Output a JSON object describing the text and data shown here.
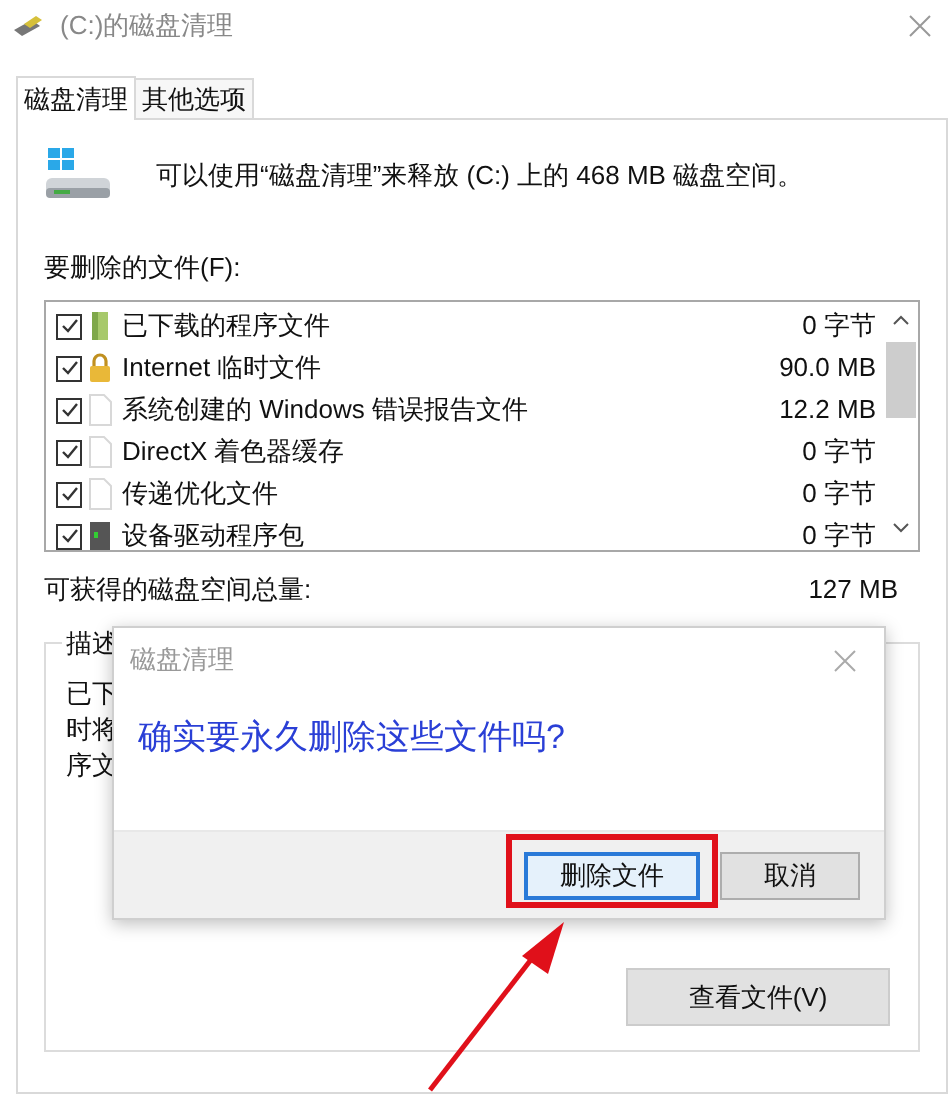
{
  "window": {
    "title": "(C:)的磁盘清理"
  },
  "tabs": [
    {
      "label": "磁盘清理",
      "selected": true
    },
    {
      "label": "其他选项",
      "selected": false
    }
  ],
  "summary": "可以使用“磁盘清理”来释放 (C:) 上的 468 MB 磁盘空间。",
  "files_label": "要删除的文件(F):",
  "files": [
    {
      "kind": "download",
      "name": "已下载的程序文件",
      "size": "0 字节",
      "checked": true
    },
    {
      "kind": "locked",
      "name": "Internet 临时文件",
      "size": "90.0 MB",
      "checked": true
    },
    {
      "kind": "document",
      "name": "系统创建的 Windows 错误报告文件",
      "size": "12.2 MB",
      "checked": true
    },
    {
      "kind": "document",
      "name": "DirectX 着色器缓存",
      "size": "0 字节",
      "checked": true
    },
    {
      "kind": "document",
      "name": "传递优化文件",
      "size": "0 字节",
      "checked": true
    },
    {
      "kind": "device",
      "name": "设备驱动程序包",
      "size": "0 字节",
      "checked": true
    }
  ],
  "total": {
    "label": "可获得的磁盘空间总量:",
    "value": "127 MB"
  },
  "description": {
    "label": "描述",
    "lines": [
      "已下",
      "时将",
      "序文"
    ]
  },
  "view_files_button": "查看文件(V)",
  "dialog": {
    "title": "磁盘清理",
    "question": "确实要永久删除这些文件吗?",
    "buttons": [
      {
        "label": "删除文件",
        "default": true
      },
      {
        "label": "取消",
        "default": false
      }
    ]
  }
}
